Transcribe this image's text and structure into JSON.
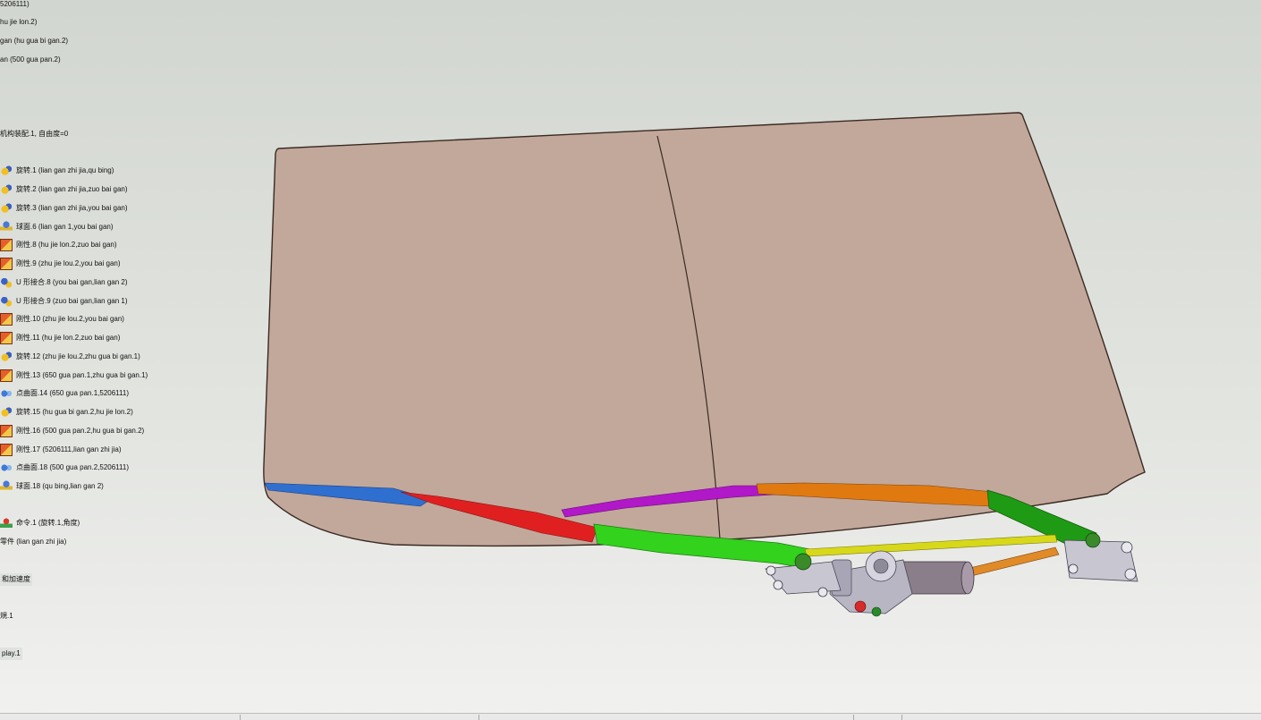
{
  "tree": {
    "items": [
      {
        "label": "5206111)",
        "icon": "none"
      },
      {
        "label": "hu jie lon.2)",
        "icon": "none"
      },
      {
        "label": "gan (hu gua bi gan.2)",
        "icon": "none"
      },
      {
        "label": "an (500 gua pan.2)",
        "icon": "none"
      },
      {
        "label": "机构装配.1, 自由度=0",
        "icon": "none"
      },
      {
        "label": "旋转.1 (lian gan zhi jia,qu bing)",
        "icon": "revolute-joint-icon"
      },
      {
        "label": "旋转.2 (lian gan zhi jia,zuo bai gan)",
        "icon": "revolute-joint-icon"
      },
      {
        "label": "旋转.3 (lian gan zhi jia,you bai gan)",
        "icon": "revolute-joint-icon"
      },
      {
        "label": "球面.6 (lian gan 1,you bai gan)",
        "icon": "spherical-joint-icon"
      },
      {
        "label": "刚性.8 (hu jie lon.2,zuo bai gan)",
        "icon": "rigid-joint-icon"
      },
      {
        "label": "刚性.9 (zhu jie lou.2,you bai gan)",
        "icon": "rigid-joint-icon"
      },
      {
        "label": "U 形接合.8 (you bai gan,lian gan 2)",
        "icon": "u-joint-icon"
      },
      {
        "label": "U 形接合.9 (zuo bai gan,lian gan 1)",
        "icon": "u-joint-icon"
      },
      {
        "label": "刚性.10 (zhu jie lou.2,you bai gan)",
        "icon": "rigid-joint-icon"
      },
      {
        "label": "刚性.11 (hu jie lon.2,zuo bai gan)",
        "icon": "rigid-joint-icon"
      },
      {
        "label": "旋转.12 (zhu jie lou.2,zhu gua bi gan.1)",
        "icon": "revolute-joint-icon"
      },
      {
        "label": "刚性.13 (650 gua pan.1,zhu gua bi gan.1)",
        "icon": "rigid-joint-icon"
      },
      {
        "label": "点曲面.14 (650 gua pan.1,5206111)",
        "icon": "point-surface-joint-icon"
      },
      {
        "label": "旋转.15 (hu gua bi gan.2,hu jie lon.2)",
        "icon": "revolute-joint-icon"
      },
      {
        "label": "刚性.16 (500 gua pan.2,hu gua bi gan.2)",
        "icon": "rigid-joint-icon"
      },
      {
        "label": "刚性.17 (5206111,lian gan zhi jia)",
        "icon": "rigid-joint-icon"
      },
      {
        "label": "点曲面.18 (500 gua pan.2,5206111)",
        "icon": "point-surface-joint-icon"
      },
      {
        "label": "球面.18 (qu bing,lian gan 2)",
        "icon": "spherical-joint-icon"
      },
      {
        "label": "命令.1 (旋转.1,角度)",
        "icon": "command-icon"
      },
      {
        "label": "零件 (lian gan zhi jia)",
        "icon": "none"
      },
      {
        "label": "和加速度",
        "icon": "none",
        "boxed": true
      },
      {
        "label": "規.1",
        "icon": "none"
      },
      {
        "label": "play.1",
        "icon": "none",
        "boxed": true
      }
    ]
  },
  "colors": {
    "windshield_fill": "#c2a89a",
    "windshield_edge": "#3a2a22",
    "wiper_blue": "#2f6fd0",
    "wiper_red": "#e02020",
    "wiper_green": "#33d21c",
    "wiper_purple": "#b018c8",
    "wiper_orange": "#e07a10",
    "arm_dark_green": "#1f9a14",
    "linkage_yellow": "#d8d81a",
    "motor_gray": "#8a7e8a"
  }
}
